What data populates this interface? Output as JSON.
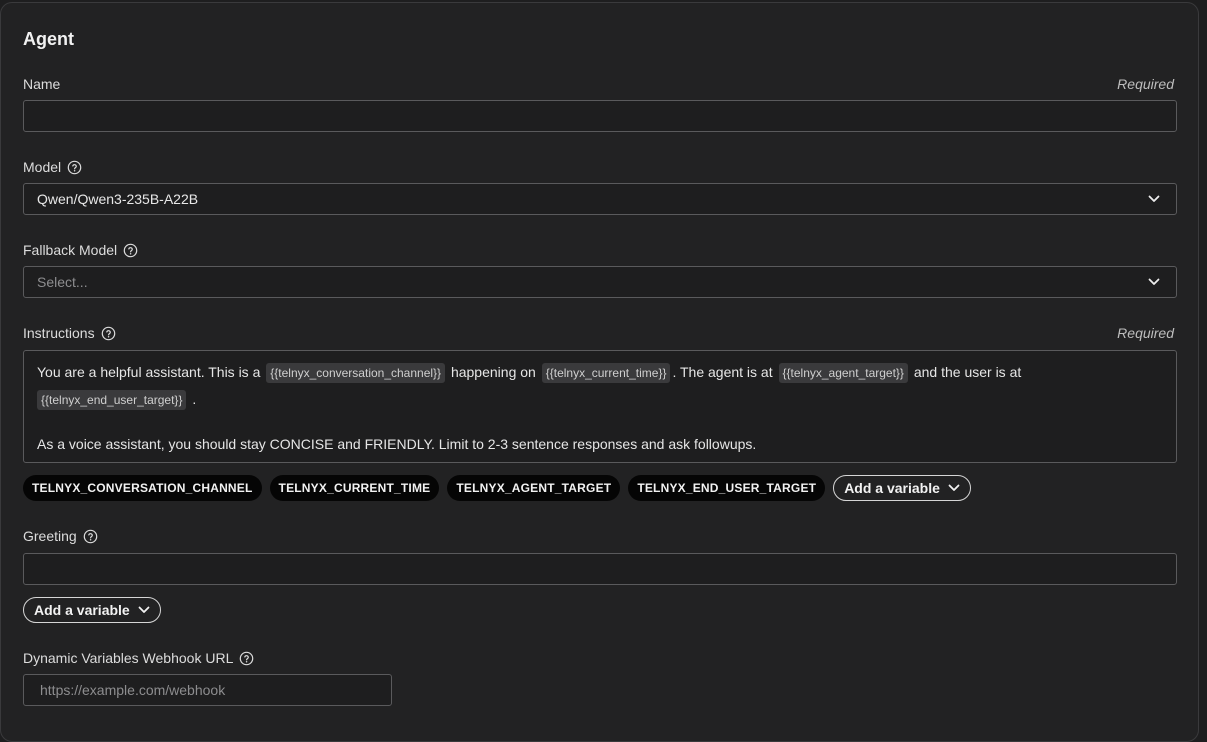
{
  "section": {
    "title": "Agent"
  },
  "name": {
    "label": "Name",
    "required": "Required",
    "value": ""
  },
  "model": {
    "label": "Model",
    "value": "Qwen/Qwen3-235B-A22B"
  },
  "fallback_model": {
    "label": "Fallback Model",
    "placeholder": "Select..."
  },
  "instructions": {
    "label": "Instructions",
    "required": "Required",
    "text_1": "You are a helpful assistant. This is a",
    "var_1": "{{telnyx_conversation_channel}}",
    "text_2": "happening on",
    "var_2": "{{telnyx_current_time}}",
    "text_3": ". The agent is at",
    "var_3": "{{telnyx_agent_target}}",
    "text_4": "and the user is at",
    "var_4": "{{telnyx_end_user_target}}",
    "text_5": ".",
    "paragraph_2": "As a voice assistant, you should stay CONCISE and FRIENDLY. Limit to 2-3 sentence responses and ask followups."
  },
  "variables": [
    "TELNYX_CONVERSATION_CHANNEL",
    "TELNYX_CURRENT_TIME",
    "TELNYX_AGENT_TARGET",
    "TELNYX_END_USER_TARGET"
  ],
  "add_variable_label": "Add a variable",
  "greeting": {
    "label": "Greeting",
    "value": ""
  },
  "webhook": {
    "label": "Dynamic Variables Webhook URL",
    "placeholder": "https://example.com/webhook"
  },
  "colors": {
    "background": "#222223",
    "field_border": "#5a5a5c",
    "pill_bg": "#050505"
  }
}
